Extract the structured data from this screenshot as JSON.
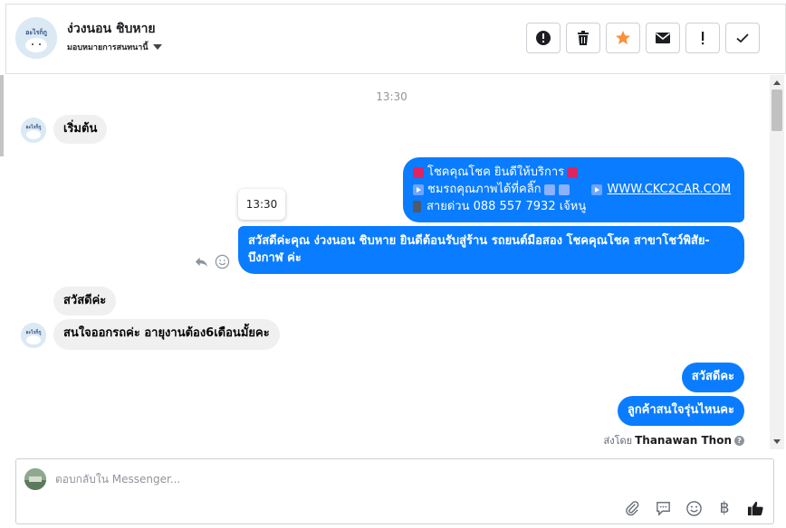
{
  "header": {
    "contact_name": "ง่วงนอน ชิบหาย",
    "assign_label": "มอบหมายการสนทนานี้",
    "actions": [
      {
        "icon": "alert-circle-icon",
        "label": "spam"
      },
      {
        "icon": "trash-icon",
        "label": "delete"
      },
      {
        "icon": "star-icon",
        "label": "star"
      },
      {
        "icon": "envelope-icon",
        "label": "mark-unread"
      },
      {
        "icon": "exclamation-icon",
        "label": "follow-up"
      },
      {
        "icon": "check-icon",
        "label": "done"
      }
    ]
  },
  "chat": {
    "timestamp": "13:30",
    "tooltip_time": "13:30",
    "messages": {
      "start": "เริ่มต้น",
      "promo_line1": "โชคคุณโชค ยินดีให้บริการ",
      "promo_line2": "ชมรถคุณภาพได้ที่คลิ๊ก",
      "promo_link": "WWW.CKC2CAR.COM",
      "promo_line3": "สายด่วน 088 557 7932 เจ้หนู",
      "welcome": "สวัสดีค่ะคุณ ง่วงนอน ชิบหาย ยินดีต้อนรับสู่ร้าน รถยนต์มือสอง โชคคุณโชค สาขาโชว์พิสัย-บึงกาฬ ค่ะ",
      "greet_in": "สวัสดีค่ะ",
      "question_in": "สนใจออกรถค่ะ อายุงานต้อง6เดือนมั้ยคะ",
      "hi_out": "สวัสดีคะ",
      "ask_out": "ลูกค้าสนใจรุ่นไหนคะ"
    },
    "sent_by_prefix": "ส่งโดย",
    "sent_by_name": "Thanawan Thon",
    "avatar_text": "อะไรก็กู"
  },
  "composer": {
    "placeholder": "ตอบกลับใน Messenger...",
    "value": "",
    "tools": [
      "paperclip-icon",
      "saved-reply-icon",
      "emoji-icon",
      "baht-icon",
      "like-icon"
    ],
    "baht_symbol": "฿"
  },
  "colors": {
    "outgoing": "#0a7cff",
    "incoming": "#f1f0f0",
    "star": "#f7923b"
  }
}
